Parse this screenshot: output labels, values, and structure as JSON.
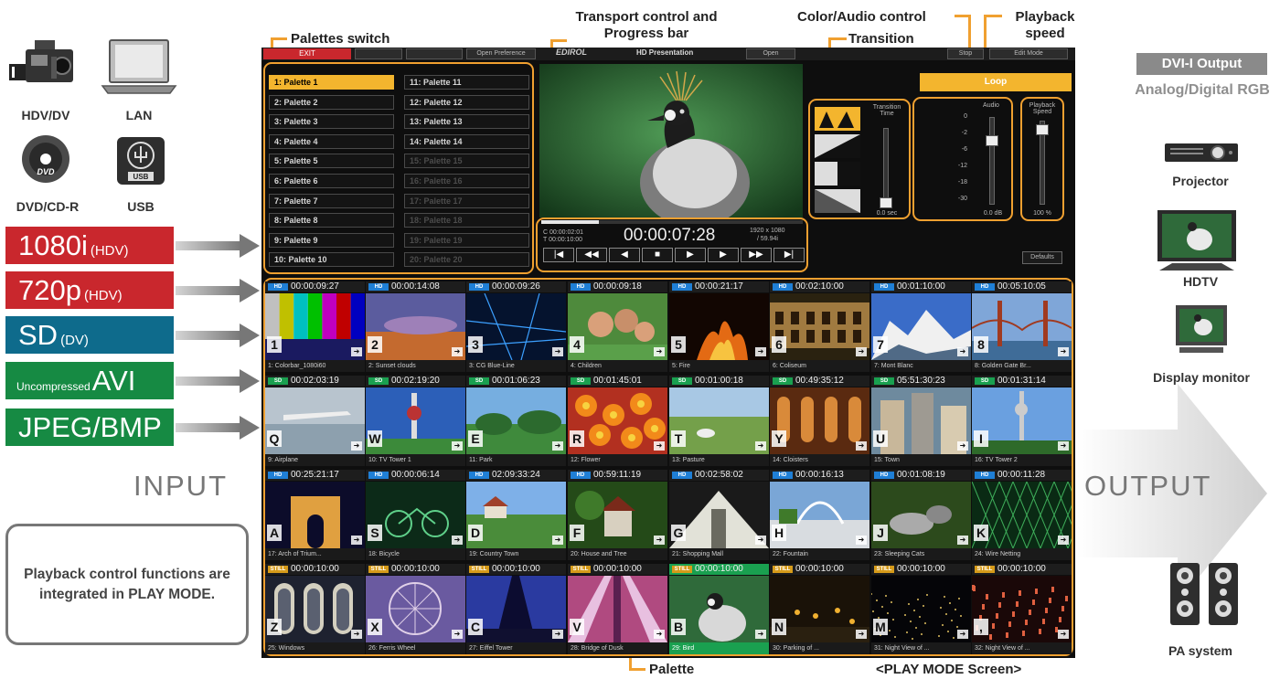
{
  "inputs": {
    "devices": [
      "HDV/DV",
      "LAN",
      "DVD/CD-R",
      "USB"
    ],
    "formats": [
      {
        "pre": "",
        "main": "1080i",
        "sub": "(HDV)",
        "color": "#c9272d"
      },
      {
        "pre": "",
        "main": "720p",
        "sub": "(HDV)",
        "color": "#c9272d"
      },
      {
        "pre": "",
        "main": "SD",
        "sub": "(DV)",
        "color": "#0e6b8c"
      },
      {
        "pre": "Uncompressed",
        "main": "AVI",
        "sub": "",
        "color": "#168a43"
      },
      {
        "pre": "",
        "main": "JPEG/BMP",
        "sub": "",
        "color": "#168a43"
      }
    ],
    "label": "INPUT",
    "note": "Playback control functions are integrated in PLAY MODE."
  },
  "outputs": {
    "title": "DVI-I Output",
    "subtitle": "Analog/Digital RGB",
    "label": "OUTPUT",
    "devices": [
      "Projector",
      "HDTV",
      "Display monitor",
      "PA system"
    ]
  },
  "annotations": {
    "palettes_switch": "Palettes switch",
    "transport": "Transport control and Progress bar",
    "color_audio": "Color/Audio control",
    "transition": "Transition",
    "playback_speed": "Playback speed",
    "palette": "Palette",
    "screen_caption": "<PLAY MODE Screen>"
  },
  "screen": {
    "exit": "EXIT",
    "topbar_buttons": [
      "Open Preference",
      "Open",
      "Stop",
      "Edit Mode"
    ],
    "logo": "EDIROL",
    "title": "HD Presentation",
    "palettes": [
      {
        "label": "1: Palette 1",
        "state": "active"
      },
      {
        "label": "2: Palette 2",
        "state": "normal"
      },
      {
        "label": "3: Palette 3",
        "state": "normal"
      },
      {
        "label": "4: Palette 4",
        "state": "normal"
      },
      {
        "label": "5: Palette 5",
        "state": "normal"
      },
      {
        "label": "6: Palette 6",
        "state": "normal"
      },
      {
        "label": "7: Palette 7",
        "state": "normal"
      },
      {
        "label": "8: Palette 8",
        "state": "normal"
      },
      {
        "label": "9: Palette 9",
        "state": "normal"
      },
      {
        "label": "10: Palette 10",
        "state": "normal"
      },
      {
        "label": "11: Palette 11",
        "state": "normal"
      },
      {
        "label": "12: Palette 12",
        "state": "normal"
      },
      {
        "label": "13: Palette 13",
        "state": "normal"
      },
      {
        "label": "14: Palette 14",
        "state": "normal"
      },
      {
        "label": "15: Palette 15",
        "state": "dim"
      },
      {
        "label": "16: Palette 16",
        "state": "dim"
      },
      {
        "label": "17: Palette 17",
        "state": "dim"
      },
      {
        "label": "18: Palette 18",
        "state": "dim"
      },
      {
        "label": "19: Palette 19",
        "state": "dim"
      },
      {
        "label": "20: Palette 20",
        "state": "dim"
      }
    ],
    "transport": {
      "time": "00:00:07:28",
      "current": "C 00:00:02:01",
      "total": "T 00:00:10:00",
      "resolution": "1920 x 1080",
      "framerate": "/ 59.94i",
      "progress": 0.22,
      "buttons": [
        "|◀",
        "◀◀",
        "◀",
        "■",
        "▶",
        "▶",
        "▶▶",
        "▶|"
      ]
    },
    "loop": "Loop",
    "transition_time_label": "Transition Time",
    "transition_time_value": "0.0 sec",
    "audio_label": "Audio",
    "audio_value": "0.0 dB",
    "meter_ticks": [
      "0",
      "-2",
      "-6",
      "-12",
      "-18",
      "-30"
    ],
    "speed_label": "Playback Speed",
    "speed_value": "100 %",
    "defaults": "Defaults",
    "clips": [
      {
        "badge": "HD",
        "dur": "00:00:09:27",
        "key": "1",
        "name": "1: Colorbar_1080i60",
        "img": "bars"
      },
      {
        "badge": "HD",
        "dur": "00:00:14:08",
        "key": "2",
        "name": "2: Sunset clouds",
        "img": "sunset"
      },
      {
        "badge": "HD",
        "dur": "00:00:09:26",
        "key": "3",
        "name": "3: CG Blue-Line",
        "img": "cgblue"
      },
      {
        "badge": "HD",
        "dur": "00:00:09:18",
        "key": "4",
        "name": "4: Children",
        "img": "children"
      },
      {
        "badge": "HD",
        "dur": "00:00:21:17",
        "key": "5",
        "name": "5: Fire",
        "img": "fire"
      },
      {
        "badge": "HD",
        "dur": "00:02:10:00",
        "key": "6",
        "name": "6: Coliseum",
        "img": "coliseum"
      },
      {
        "badge": "HD",
        "dur": "00:01:10:00",
        "key": "7",
        "name": "7: Mont Blanc",
        "img": "mont"
      },
      {
        "badge": "HD",
        "dur": "00:05:10:05",
        "key": "8",
        "name": "8: Golden Gate Br...",
        "img": "golden"
      },
      {
        "badge": "SD",
        "dur": "00:02:03:19",
        "key": "Q",
        "name": "9: Airplane",
        "img": "airplane"
      },
      {
        "badge": "SD",
        "dur": "00:02:19:20",
        "key": "W",
        "name": "10: TV Tower 1",
        "img": "tvtower"
      },
      {
        "badge": "SD",
        "dur": "00:01:06:23",
        "key": "E",
        "name": "11: Park",
        "img": "park"
      },
      {
        "badge": "SD",
        "dur": "00:01:45:01",
        "key": "R",
        "name": "12: Flower",
        "img": "flower"
      },
      {
        "badge": "SD",
        "dur": "00:01:00:18",
        "key": "T",
        "name": "13: Pasture",
        "img": "pasture"
      },
      {
        "badge": "SD",
        "dur": "00:49:35:12",
        "key": "Y",
        "name": "14: Cloisters",
        "img": "cloisters"
      },
      {
        "badge": "SD",
        "dur": "05:51:30:23",
        "key": "U",
        "name": "15: Town",
        "img": "town"
      },
      {
        "badge": "SD",
        "dur": "00:01:31:14",
        "key": "I",
        "name": "16: TV Tower 2",
        "img": "tvtower2"
      },
      {
        "badge": "HD",
        "dur": "00:25:21:17",
        "key": "A",
        "name": "17: Arch of Trium...",
        "img": "arch"
      },
      {
        "badge": "HD",
        "dur": "00:00:06:14",
        "key": "S",
        "name": "18: Bicycle",
        "img": "bicycle"
      },
      {
        "badge": "HD",
        "dur": "02:09:33:24",
        "key": "D",
        "name": "19: Country Town",
        "img": "country"
      },
      {
        "badge": "HD",
        "dur": "00:59:11:19",
        "key": "F",
        "name": "20: House and Tree",
        "img": "house"
      },
      {
        "badge": "HD",
        "dur": "00:02:58:02",
        "key": "G",
        "name": "21: Shopping Mall",
        "img": "mall"
      },
      {
        "badge": "HD",
        "dur": "00:00:16:13",
        "key": "H",
        "name": "22: Fountain",
        "img": "fountain"
      },
      {
        "badge": "HD",
        "dur": "00:01:08:19",
        "key": "J",
        "name": "23: Sleeping Cats",
        "img": "cats"
      },
      {
        "badge": "HD",
        "dur": "00:00:11:28",
        "key": "K",
        "name": "24: Wire Netting",
        "img": "wire"
      },
      {
        "badge": "STILL",
        "dur": "00:00:10:00",
        "key": "Z",
        "name": "25: Windows",
        "img": "windows"
      },
      {
        "badge": "STILL",
        "dur": "00:00:10:00",
        "key": "X",
        "name": "26: Ferris Wheel",
        "img": "ferris"
      },
      {
        "badge": "STILL",
        "dur": "00:00:10:00",
        "key": "C",
        "name": "27: Eiffel Tower",
        "img": "eiffel"
      },
      {
        "badge": "STILL",
        "dur": "00:00:10:00",
        "key": "V",
        "name": "28: Bridge of Dusk",
        "img": "bridge"
      },
      {
        "badge": "STILL",
        "dur": "00:00:10:00",
        "key": "B",
        "name": "29: Bird",
        "img": "bird",
        "live": true
      },
      {
        "badge": "STILL",
        "dur": "00:00:10:00",
        "key": "N",
        "name": "30: Parking of ...",
        "img": "parking"
      },
      {
        "badge": "STILL",
        "dur": "00:00:10:00",
        "key": "M",
        "name": "31: Night View of ...",
        "img": "night"
      },
      {
        "badge": "STILL",
        "dur": "00:00:10:00",
        "key": ",",
        "name": "32: Night View of ...",
        "img": "night2"
      }
    ]
  },
  "colors": {
    "accent_orange": "#f0a030",
    "hd_badge": "#1f7fd6",
    "sd_badge": "#1aa050",
    "still_badge": "#d69b1a",
    "live_green": "#1aa050"
  }
}
